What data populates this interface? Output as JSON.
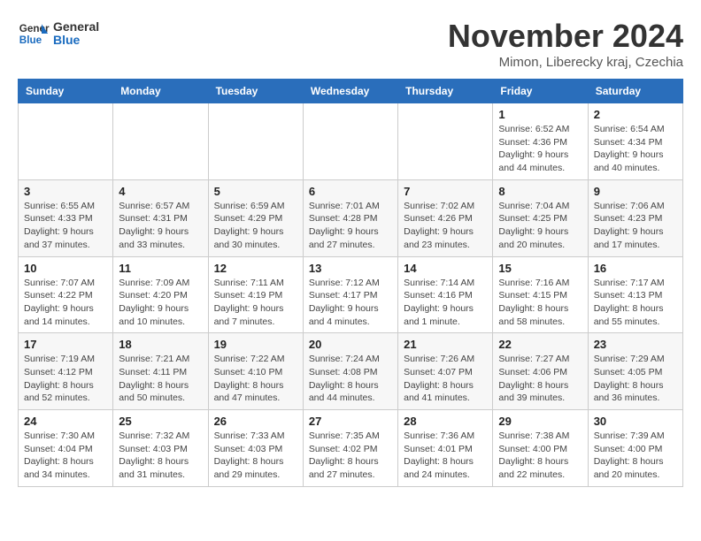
{
  "header": {
    "logo_general": "General",
    "logo_blue": "Blue",
    "month_title": "November 2024",
    "location": "Mimon, Liberecky kraj, Czechia"
  },
  "weekdays": [
    "Sunday",
    "Monday",
    "Tuesday",
    "Wednesday",
    "Thursday",
    "Friday",
    "Saturday"
  ],
  "weeks": [
    [
      {
        "day": "",
        "detail": ""
      },
      {
        "day": "",
        "detail": ""
      },
      {
        "day": "",
        "detail": ""
      },
      {
        "day": "",
        "detail": ""
      },
      {
        "day": "",
        "detail": ""
      },
      {
        "day": "1",
        "detail": "Sunrise: 6:52 AM\nSunset: 4:36 PM\nDaylight: 9 hours\nand 44 minutes."
      },
      {
        "day": "2",
        "detail": "Sunrise: 6:54 AM\nSunset: 4:34 PM\nDaylight: 9 hours\nand 40 minutes."
      }
    ],
    [
      {
        "day": "3",
        "detail": "Sunrise: 6:55 AM\nSunset: 4:33 PM\nDaylight: 9 hours\nand 37 minutes."
      },
      {
        "day": "4",
        "detail": "Sunrise: 6:57 AM\nSunset: 4:31 PM\nDaylight: 9 hours\nand 33 minutes."
      },
      {
        "day": "5",
        "detail": "Sunrise: 6:59 AM\nSunset: 4:29 PM\nDaylight: 9 hours\nand 30 minutes."
      },
      {
        "day": "6",
        "detail": "Sunrise: 7:01 AM\nSunset: 4:28 PM\nDaylight: 9 hours\nand 27 minutes."
      },
      {
        "day": "7",
        "detail": "Sunrise: 7:02 AM\nSunset: 4:26 PM\nDaylight: 9 hours\nand 23 minutes."
      },
      {
        "day": "8",
        "detail": "Sunrise: 7:04 AM\nSunset: 4:25 PM\nDaylight: 9 hours\nand 20 minutes."
      },
      {
        "day": "9",
        "detail": "Sunrise: 7:06 AM\nSunset: 4:23 PM\nDaylight: 9 hours\nand 17 minutes."
      }
    ],
    [
      {
        "day": "10",
        "detail": "Sunrise: 7:07 AM\nSunset: 4:22 PM\nDaylight: 9 hours\nand 14 minutes."
      },
      {
        "day": "11",
        "detail": "Sunrise: 7:09 AM\nSunset: 4:20 PM\nDaylight: 9 hours\nand 10 minutes."
      },
      {
        "day": "12",
        "detail": "Sunrise: 7:11 AM\nSunset: 4:19 PM\nDaylight: 9 hours\nand 7 minutes."
      },
      {
        "day": "13",
        "detail": "Sunrise: 7:12 AM\nSunset: 4:17 PM\nDaylight: 9 hours\nand 4 minutes."
      },
      {
        "day": "14",
        "detail": "Sunrise: 7:14 AM\nSunset: 4:16 PM\nDaylight: 9 hours\nand 1 minute."
      },
      {
        "day": "15",
        "detail": "Sunrise: 7:16 AM\nSunset: 4:15 PM\nDaylight: 8 hours\nand 58 minutes."
      },
      {
        "day": "16",
        "detail": "Sunrise: 7:17 AM\nSunset: 4:13 PM\nDaylight: 8 hours\nand 55 minutes."
      }
    ],
    [
      {
        "day": "17",
        "detail": "Sunrise: 7:19 AM\nSunset: 4:12 PM\nDaylight: 8 hours\nand 52 minutes."
      },
      {
        "day": "18",
        "detail": "Sunrise: 7:21 AM\nSunset: 4:11 PM\nDaylight: 8 hours\nand 50 minutes."
      },
      {
        "day": "19",
        "detail": "Sunrise: 7:22 AM\nSunset: 4:10 PM\nDaylight: 8 hours\nand 47 minutes."
      },
      {
        "day": "20",
        "detail": "Sunrise: 7:24 AM\nSunset: 4:08 PM\nDaylight: 8 hours\nand 44 minutes."
      },
      {
        "day": "21",
        "detail": "Sunrise: 7:26 AM\nSunset: 4:07 PM\nDaylight: 8 hours\nand 41 minutes."
      },
      {
        "day": "22",
        "detail": "Sunrise: 7:27 AM\nSunset: 4:06 PM\nDaylight: 8 hours\nand 39 minutes."
      },
      {
        "day": "23",
        "detail": "Sunrise: 7:29 AM\nSunset: 4:05 PM\nDaylight: 8 hours\nand 36 minutes."
      }
    ],
    [
      {
        "day": "24",
        "detail": "Sunrise: 7:30 AM\nSunset: 4:04 PM\nDaylight: 8 hours\nand 34 minutes."
      },
      {
        "day": "25",
        "detail": "Sunrise: 7:32 AM\nSunset: 4:03 PM\nDaylight: 8 hours\nand 31 minutes."
      },
      {
        "day": "26",
        "detail": "Sunrise: 7:33 AM\nSunset: 4:03 PM\nDaylight: 8 hours\nand 29 minutes."
      },
      {
        "day": "27",
        "detail": "Sunrise: 7:35 AM\nSunset: 4:02 PM\nDaylight: 8 hours\nand 27 minutes."
      },
      {
        "day": "28",
        "detail": "Sunrise: 7:36 AM\nSunset: 4:01 PM\nDaylight: 8 hours\nand 24 minutes."
      },
      {
        "day": "29",
        "detail": "Sunrise: 7:38 AM\nSunset: 4:00 PM\nDaylight: 8 hours\nand 22 minutes."
      },
      {
        "day": "30",
        "detail": "Sunrise: 7:39 AM\nSunset: 4:00 PM\nDaylight: 8 hours\nand 20 minutes."
      }
    ]
  ]
}
